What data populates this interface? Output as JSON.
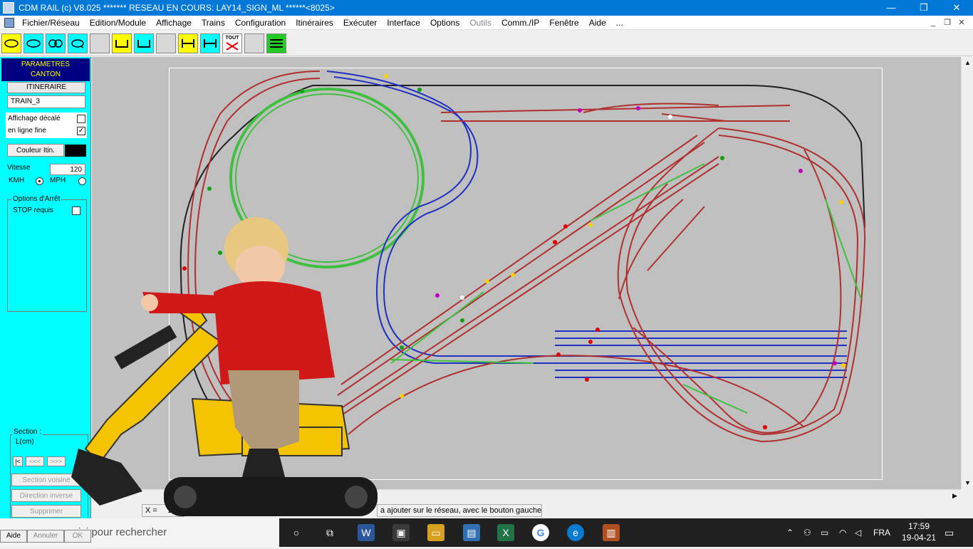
{
  "window": {
    "title": "CDM RAIL (c) V8.025     ******* RESEAU EN COURS: LAY14_SIGN_ML ******<8025>",
    "minimize": "—",
    "maximize": "❐",
    "close": "✕"
  },
  "menu": {
    "items": [
      {
        "label": "Fichier/Réseau",
        "disabled": false
      },
      {
        "label": "Edition/Module",
        "disabled": false
      },
      {
        "label": "Affichage",
        "disabled": false
      },
      {
        "label": "Trains",
        "disabled": false
      },
      {
        "label": "Configuration",
        "disabled": false
      },
      {
        "label": "Itinéraires",
        "disabled": false
      },
      {
        "label": "Exécuter",
        "disabled": false
      },
      {
        "label": "Interface",
        "disabled": false
      },
      {
        "label": "Options",
        "disabled": false
      },
      {
        "label": "Outils",
        "disabled": true
      },
      {
        "label": "Comm./IP",
        "disabled": false
      },
      {
        "label": "Fenêtre",
        "disabled": false
      },
      {
        "label": "Aide",
        "disabled": false
      },
      {
        "label": "...",
        "disabled": false
      }
    ],
    "mdi_min": "_",
    "mdi_restore": "❐",
    "mdi_close": "✕"
  },
  "toolbar": {
    "tout_label": "TOUT"
  },
  "left_panel": {
    "header_line1": "PARAMETRES",
    "header_line2": "CANTON",
    "itineraire_label": "ITINERAIRE",
    "train_value": "TRAIN_3",
    "affichage_decale_label": "Affichage décalé",
    "affichage_decale_checked": false,
    "ligne_fine_label": "en ligne fine",
    "ligne_fine_checked": true,
    "couleur_itin_label": "Couleur Itin.",
    "couleur_itin_color": "#000000",
    "vitesse_label": "Vitesse",
    "vitesse_value": "120",
    "kmh_label": "KMH",
    "mph_label": "MPH",
    "unit_selected": "KMH",
    "options_arret_label": "Options d'Arrêt",
    "stop_requis_label": "STOP requis",
    "stop_requis_checked": false,
    "section_label": "Section :",
    "section_unit": "L(cm)",
    "nav_first": "|<",
    "nav_prev": "<<<",
    "nav_next": ">>>",
    "section_voisine": "Section voisine",
    "direction_inverse": "Direction inverse",
    "supprimer": "Supprimer",
    "aide": "Aide",
    "annuler": "Annuler",
    "ok": "OK"
  },
  "status": {
    "x_label": "X =",
    "x_value": "205.63",
    "message": "a ajouter sur le réseau, avec le bouton gauche"
  },
  "taskbar": {
    "search_placeholder": "ici pour rechercher",
    "language": "FRA",
    "time": "17:59",
    "date": "19-04-21"
  },
  "colors": {
    "titlebar": "#0078d7",
    "panel": "#00ffff",
    "canvas": "#c0c0c0",
    "track_red": "#b03030",
    "track_blue": "#2030c0",
    "track_green": "#40c040",
    "track_black": "#202020"
  }
}
